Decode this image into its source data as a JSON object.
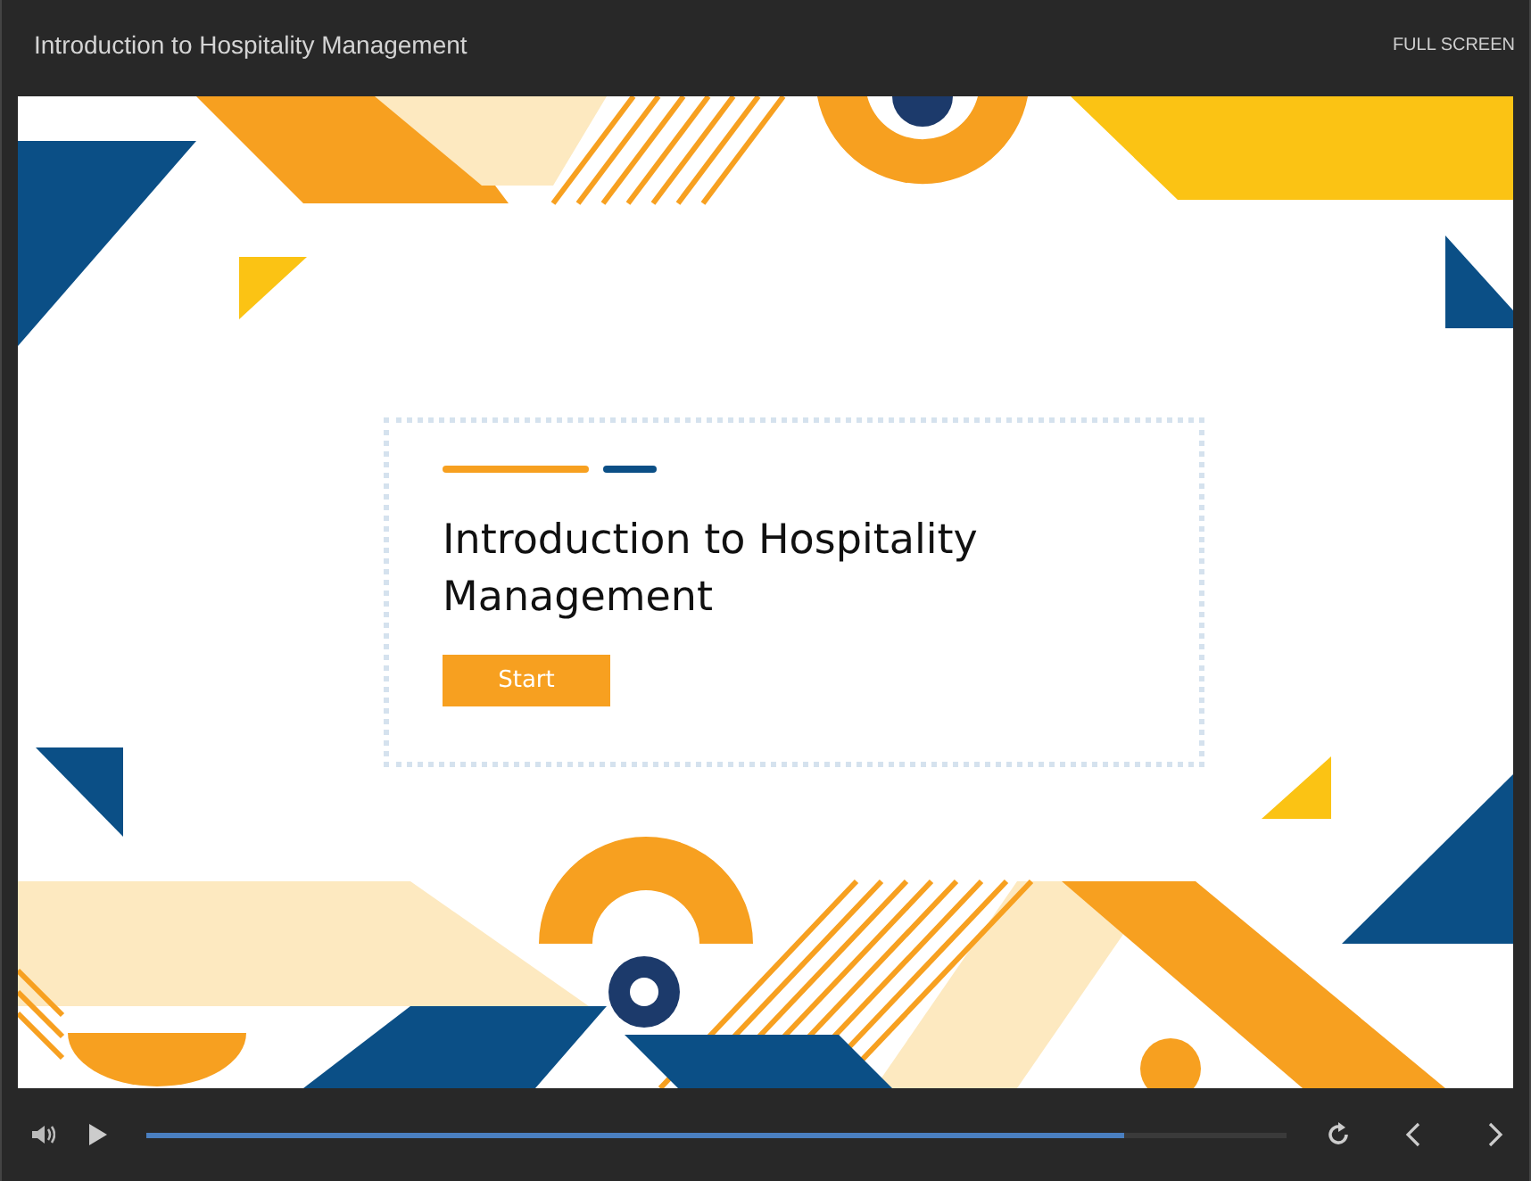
{
  "window": {
    "title": "Introduction to Hospitality Management",
    "fullscreen_label": "FULL SCREEN"
  },
  "slide": {
    "title": "Introduction to Hospitality Management",
    "start_button": "Start"
  },
  "player": {
    "progress": {
      "level": 0.857
    }
  }
}
